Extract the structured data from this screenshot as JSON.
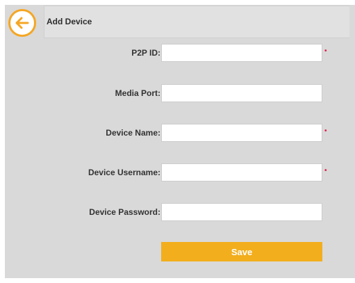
{
  "header": {
    "title": "Add Device",
    "back_icon": "arrow-left-icon",
    "accent_color": "#f5a623"
  },
  "form": {
    "fields": [
      {
        "key": "p2p_id",
        "label": "P2P ID:",
        "value": "",
        "placeholder": "",
        "required": true
      },
      {
        "key": "media_port",
        "label": "Media Port:",
        "value": "",
        "placeholder": "",
        "required": false
      },
      {
        "key": "device_name",
        "label": "Device Name:",
        "value": "",
        "placeholder": "",
        "required": true
      },
      {
        "key": "device_username",
        "label": "Device Username:",
        "value": "",
        "placeholder": "",
        "required": true
      },
      {
        "key": "device_password",
        "label": "Device Password:",
        "value": "",
        "placeholder": "",
        "required": false
      }
    ],
    "required_mark": "•",
    "required_color": "#e0204a",
    "save_label": "Save",
    "save_color": "#f2ae1c"
  }
}
